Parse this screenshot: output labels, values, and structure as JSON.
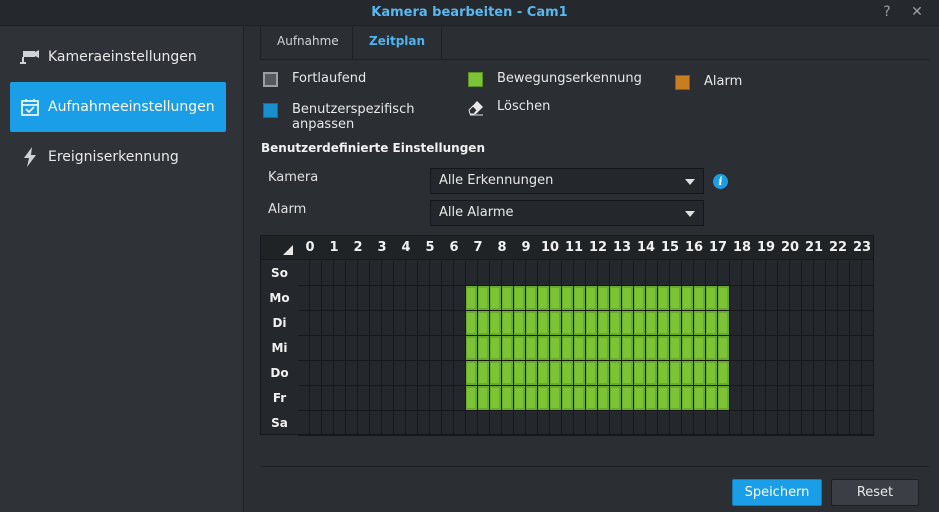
{
  "window": {
    "title": "Kamera bearbeiten - Cam1",
    "help_glyph": "?",
    "close_glyph": "✕"
  },
  "sidebar": {
    "items": [
      {
        "label": "Kameraeinstellungen",
        "icon": "camera-icon",
        "active": false
      },
      {
        "label": "Aufnahmeeinstellungen",
        "icon": "calendar-check-icon",
        "active": true
      },
      {
        "label": "Ereigniserkennung",
        "icon": "lightning-icon",
        "active": false
      }
    ]
  },
  "tabs": [
    {
      "label": "Aufnahme",
      "active": false
    },
    {
      "label": "Zeitplan",
      "active": true
    }
  ],
  "legend": {
    "continuous": {
      "label": "Fortlaufend",
      "color": "#555a60"
    },
    "custom": {
      "label_line1": "Benutzerspezifisch",
      "label_line2": "anpassen",
      "color": "#1a8fd0"
    },
    "motion": {
      "label": "Bewegungserkennung",
      "color": "#7cc436"
    },
    "erase": {
      "label": "Löschen",
      "icon": "eraser-icon"
    },
    "alarm": {
      "label": "Alarm",
      "color": "#c87d1e"
    }
  },
  "custom_settings": {
    "title": "Benutzerdefinierte Einstellungen",
    "camera_label": "Kamera",
    "camera_value": "Alle Erkennungen",
    "alarm_label": "Alarm",
    "alarm_value": "Alle Alarme"
  },
  "schedule": {
    "hours": [
      "0",
      "1",
      "2",
      "3",
      "4",
      "5",
      "6",
      "7",
      "8",
      "9",
      "10",
      "11",
      "12",
      "13",
      "14",
      "15",
      "16",
      "17",
      "18",
      "19",
      "20",
      "21",
      "22",
      "23"
    ],
    "days": [
      "So",
      "Mo",
      "Di",
      "Mi",
      "Do",
      "Fr",
      "Sa"
    ],
    "active_days": [
      "Mo",
      "Di",
      "Mi",
      "Do",
      "Fr"
    ],
    "active_from_hour": 7,
    "active_to_hour": 17,
    "active_type": "Bewegungserkennung"
  },
  "buttons": {
    "save": "Speichern",
    "reset": "Reset"
  }
}
